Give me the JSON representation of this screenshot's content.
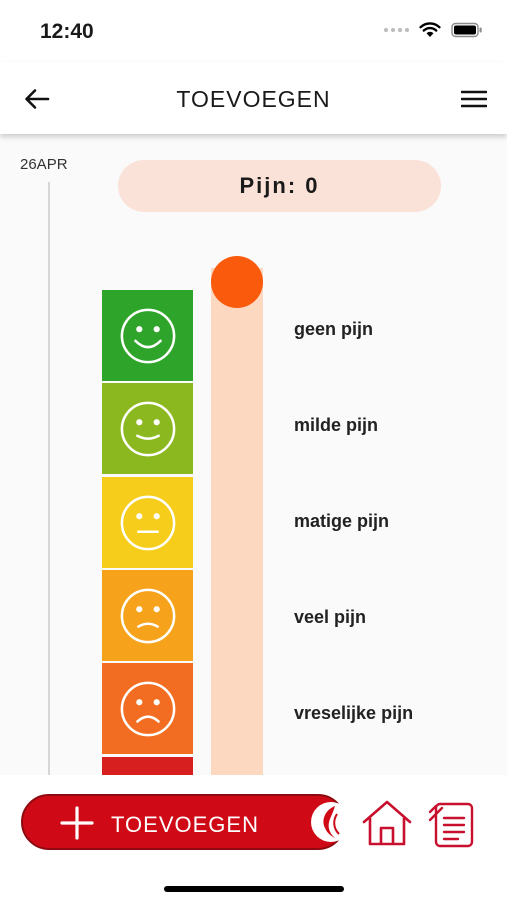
{
  "status_bar": {
    "time": "12:40"
  },
  "header": {
    "title": "TOEVOEGEN"
  },
  "timeline": {
    "date": "26APR"
  },
  "pain_value": {
    "text": "Pijn: 0",
    "value": 0
  },
  "scale": {
    "levels": [
      {
        "label": "geen pijn",
        "color": "#2ea52a",
        "face": "very-happy-face-icon"
      },
      {
        "label": "milde pijn",
        "color": "#8cb81f",
        "face": "happy-face-icon"
      },
      {
        "label": "matige pijn",
        "color": "#f5cd1a",
        "face": "neutral-face-icon"
      },
      {
        "label": "veel pijn",
        "color": "#f6a31b",
        "face": "sad-face-icon"
      },
      {
        "label": "vreselijke pijn",
        "color": "#f26d21",
        "face": "very-sad-face-icon"
      }
    ]
  },
  "bottom_bar": {
    "add_label": "TOEVOEGEN"
  },
  "colors": {
    "accent": "#cf0a16",
    "knob": "#fa5a0c",
    "track": "#fdd8c0",
    "pill": "#fbe2d8"
  }
}
